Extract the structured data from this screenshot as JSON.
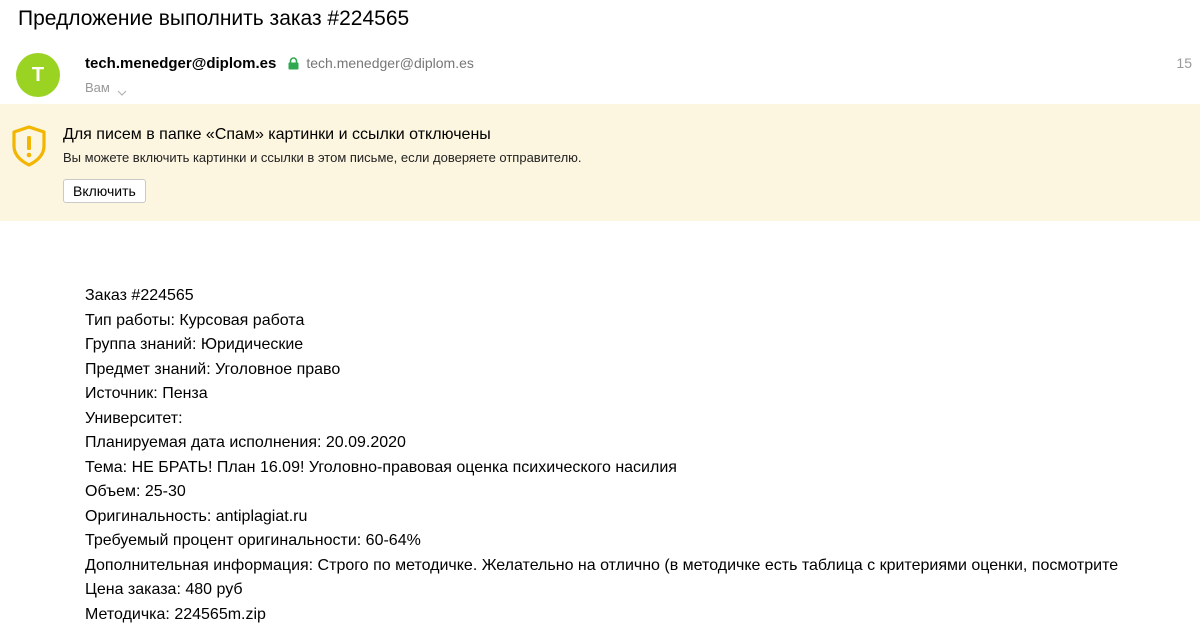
{
  "subject": "Предложение выполнить заказ #224565",
  "sender": {
    "avatar_letter": "T",
    "avatar_color": "#9bd322",
    "name": "tech.menedger@diplom.es",
    "email": "tech.menedger@diplom.es",
    "recipient_label": "Вам",
    "date": "15"
  },
  "spam_banner": {
    "background_color": "#fcf5df",
    "icon_color": "#f2b600",
    "title": "Для писем в папке «Спам» картинки и ссылки отключены",
    "text": "Вы можете включить картинки и ссылки в этом письме, если доверяете отправителю.",
    "button_label": "Включить"
  },
  "body": {
    "lines": [
      "Заказ #224565",
      "Тип работы: Курсовая работа",
      "Группа знаний: Юридические",
      "Предмет знаний: Уголовное право",
      "Источник: Пенза",
      "Университет:",
      "Планируемая дата исполнения: 20.09.2020",
      "Тема: НЕ БРАТЬ! План 16.09! Уголовно-правовая оценка психического насилия",
      "Объем: 25-30",
      "Оригинальность: antiplagiat.ru",
      "Требуемый процент оригинальности: 60-64%",
      "Дополнительная информация: Строго по методичке. Желательно на отлично (в методичке есть таблица с критериями оценки, посмотрите",
      "Цена заказа: 480 руб",
      "Методичка: 224565m.zip"
    ]
  }
}
